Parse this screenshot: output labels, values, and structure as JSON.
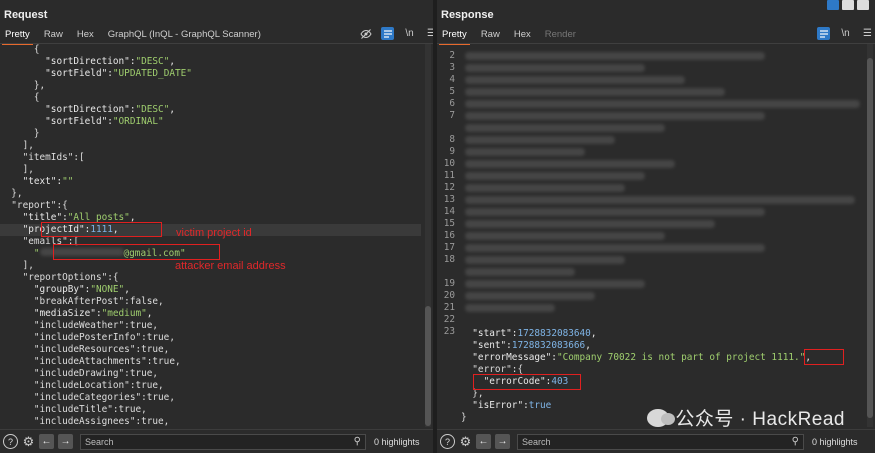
{
  "request": {
    "title": "Request",
    "tabs": [
      "Pretty",
      "Raw",
      "Hex",
      "GraphQL (InQL - GraphQL Scanner)"
    ],
    "toolbar_icons": [
      "hide-icon",
      "wrap-icon",
      "newline-icon",
      "menu-icon"
    ],
    "newline_label": "\\n",
    "code": [
      "      {",
      "        \"sortDirection\":\"DESC\",",
      "        \"sortField\":\"UPDATED_DATE\"",
      "      },",
      "      {",
      "        \"sortDirection\":\"DESC\",",
      "        \"sortField\":\"ORDINAL\"",
      "      }",
      "    ],",
      "    \"itemIds\":[",
      "    ],",
      "    \"text\":\"\"",
      "  },",
      "  \"report\":{",
      "    \"title\":\"All posts\",",
      "    \"projectId\":1111,",
      "    \"emails\":[",
      "      \"             @gmail.com\"",
      "    ],",
      "    \"reportOptions\":{",
      "      \"groupBy\":\"NONE\",",
      "      \"breakAfterPost\":false,",
      "      \"mediaSize\":\"medium\",",
      "      \"includeWeather\":true,",
      "      \"includePosterInfo\":true,",
      "      \"includeResources\":true,",
      "      \"includeAttachments\":true,",
      "      \"includeDrawing\":true,",
      "      \"includeLocation\":true,",
      "      \"includeCategories\":true,",
      "      \"includeTitle\":true,",
      "      \"includeAssignees\":true,"
    ],
    "annotations": {
      "victim": "victim project id",
      "attacker": "attacker email address"
    },
    "search_placeholder": "Search",
    "highlights": "0 highlights"
  },
  "response": {
    "title": "Response",
    "tabs": [
      "Pretty",
      "Raw",
      "Hex",
      "Render"
    ],
    "newline_label": "\\n",
    "line_numbers": [
      "2",
      "3",
      "4",
      "5",
      "6",
      "7",
      "8",
      "9",
      "10",
      "11",
      "12",
      "13",
      "14",
      "15",
      "16",
      "17",
      "18",
      "19",
      "20",
      "21",
      "22",
      "23"
    ],
    "code": [
      "  \"start\":1728832083640,",
      "  \"sent\":1728832083666,",
      "  \"errorMessage\":\"Company 70022 is not part of project 1111.\",",
      "  \"error\":{",
      "    \"errorCode\":403",
      "  },",
      "  \"isError\":true",
      "}"
    ],
    "search_placeholder": "Search",
    "highlights": "0 highlights"
  },
  "watermark": "公众号 · HackRead",
  "colors": {
    "accent_tab": "#e8692c",
    "string": "#9fce6e",
    "number": "#7fb4e6",
    "annotation": "#e0282a"
  }
}
